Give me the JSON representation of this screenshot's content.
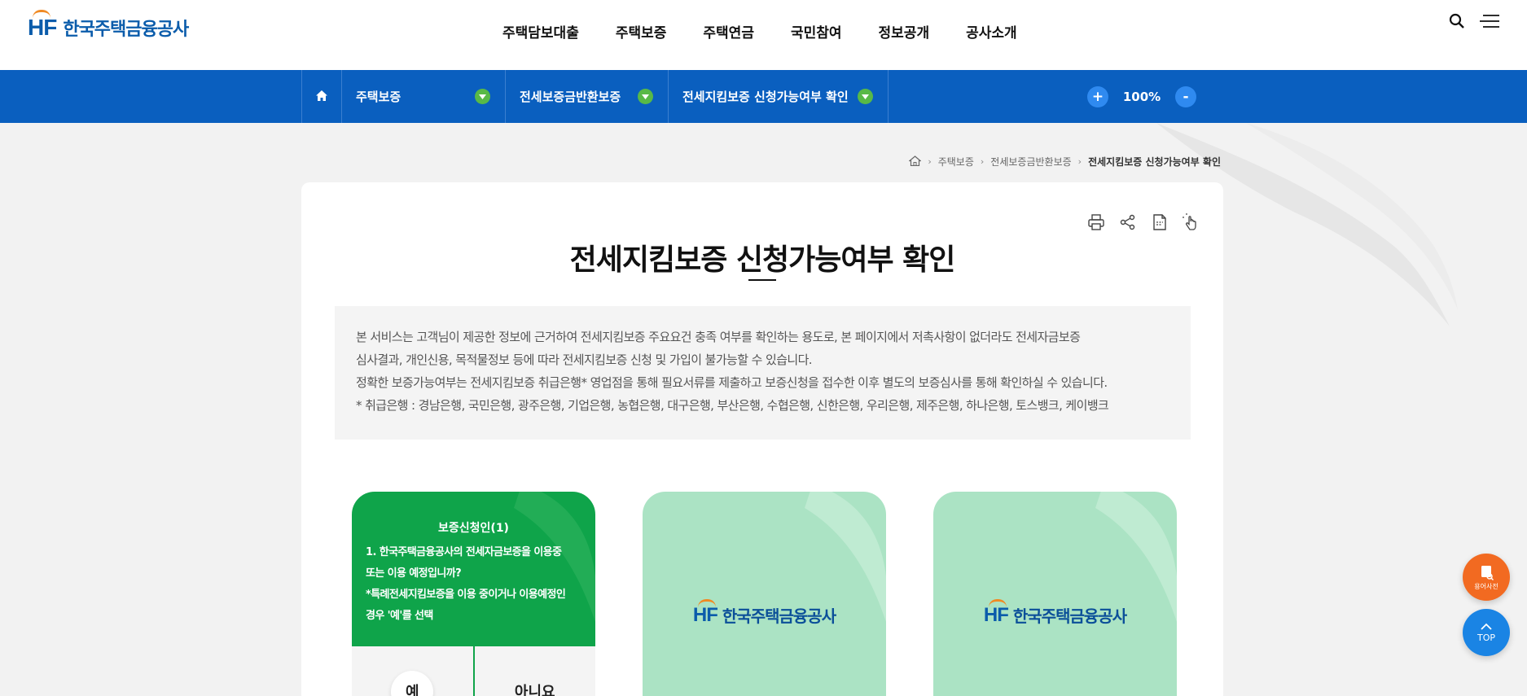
{
  "header": {
    "logo_mark": "HF",
    "logo_text": "한국주택금융공사",
    "nav": [
      "주택담보대출",
      "주택보증",
      "주택연금",
      "국민참여",
      "정보공개",
      "공사소개"
    ]
  },
  "location": {
    "depth1": "주택보증",
    "depth2": "전세보증금반환보증",
    "depth3": "전세지킴보증 신청가능여부 확인",
    "zoom_in": "+",
    "zoom_level": "100%",
    "zoom_out": "-"
  },
  "breadcrumb": [
    "주택보증",
    "전세보증금반환보증",
    "전세지킴보증 신청가능여부 확인"
  ],
  "page": {
    "title": "전세지킴보증 신청가능여부 확인",
    "notice": [
      "본 서비스는 고객님이 제공한 정보에 근거하여 전세지킴보증 주요요건 충족 여부를 확인하는 용도로, 본 페이지에서 저촉사항이 없더라도 전세자금보증",
      "심사결과, 개인신용, 목적물정보 등에 따라 전세지킴보증 신청 및 가입이 불가능할 수 있습니다.",
      "정확한 보증가능여부는 전세지킴보증 취급은행* 영업점을 통해 필요서류를 제출하고 보증신청을 접수한 이후 별도의 보증심사를 통해 확인하실 수 있습니다.",
      "* 취급은행 : 경남은행, 국민은행, 광주은행, 기업은행, 농협은행, 대구은행, 부산은행, 수협은행, 신한은행, 우리은행, 제주은행, 하나은행, 토스뱅크, 케이뱅크"
    ]
  },
  "steps": {
    "first": {
      "heading": "보증신청인(1)",
      "question_line1": "1. 한국주택금융공사의 전세자금보증을 이용중",
      "question_line2": "또는 이용 예정입니까?",
      "question_line3": "*특례전세지킴보증을 이용 중이거나 이용예정인",
      "question_line4": "경우 '예'를 선택",
      "yes": "예",
      "no": "아니요"
    },
    "second_logo": "한국주택금융공사",
    "third_logo": "한국주택금융공사"
  },
  "floating": {
    "dictionary": "용어사전",
    "top": "TOP"
  },
  "colors": {
    "brand_blue": "#0a5fbf",
    "green": "#0fa44a",
    "light_green": "#abe3c4",
    "orange": "#f26a21"
  },
  "icons": [
    "search-icon",
    "menu-icon",
    "home-icon",
    "chevron-down-icon",
    "print-icon",
    "share-icon",
    "pdf-icon",
    "touch-icon",
    "dictionary-icon",
    "arrow-up-icon"
  ]
}
